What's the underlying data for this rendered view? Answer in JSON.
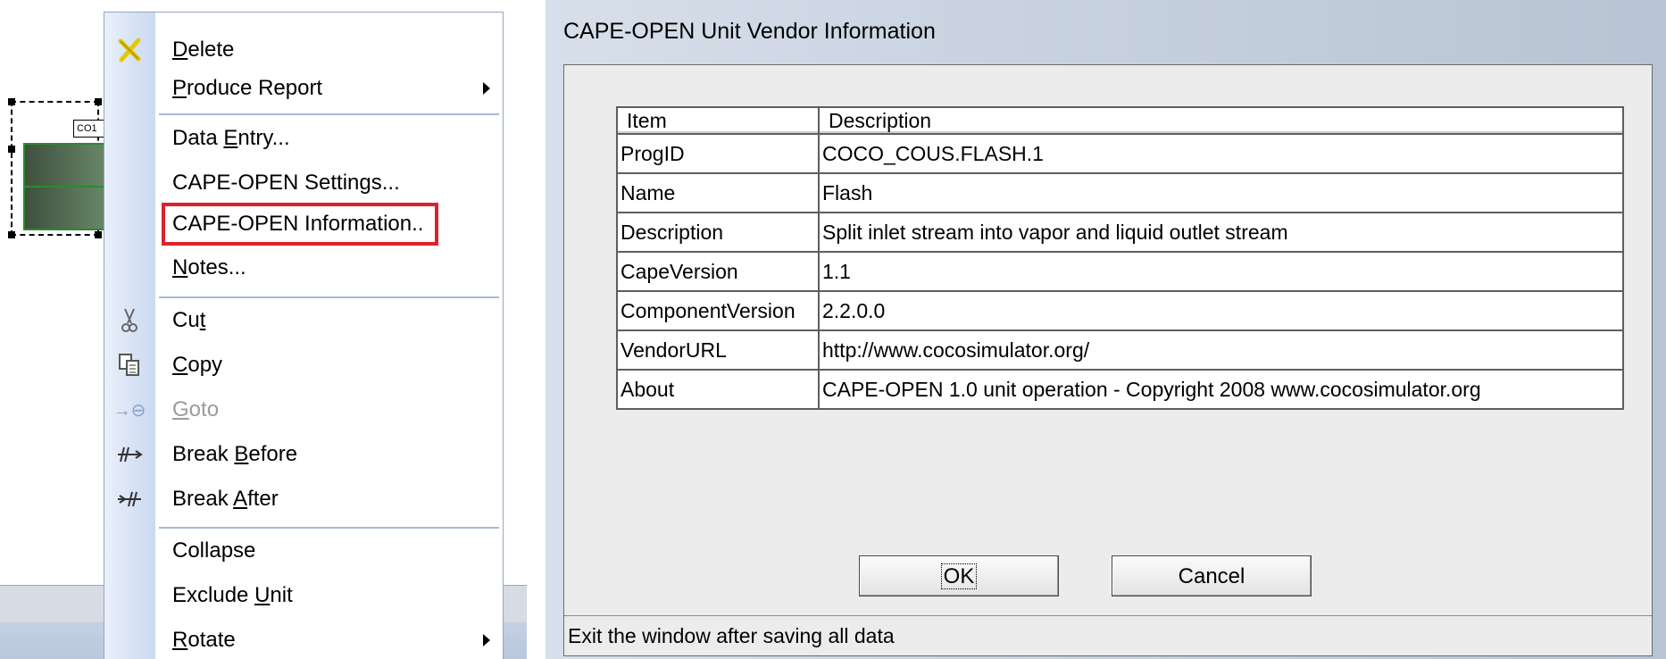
{
  "flowsheet": {
    "unit_tag": "CO1"
  },
  "context_menu": {
    "items": [
      {
        "label": "Delete",
        "icon": "delete-x-icon"
      },
      {
        "label": "Produce Report",
        "submenu": true
      },
      {
        "label": "Data Entry..."
      },
      {
        "label": "CAPE-OPEN Settings..."
      },
      {
        "label": "CAPE-OPEN Information..",
        "highlighted": true,
        "highlight_color": "#e0202a"
      },
      {
        "label": "Notes..."
      },
      {
        "label": "Cut",
        "icon": "scissors-icon"
      },
      {
        "label": "Copy",
        "icon": "copy-icon"
      },
      {
        "label": "Goto",
        "icon": "goto-icon",
        "disabled": true
      },
      {
        "label": "Break Before",
        "icon": "break-before-icon"
      },
      {
        "label": "Break After",
        "icon": "break-after-icon"
      },
      {
        "label": "Collapse"
      },
      {
        "label": "Exclude Unit"
      },
      {
        "label": "Rotate",
        "submenu": true
      }
    ]
  },
  "dialog": {
    "title": "CAPE-OPEN Unit Vendor Information",
    "table": {
      "headers": [
        "Item",
        "Description"
      ],
      "rows": [
        [
          "ProgID",
          "COCO_COUS.FLASH.1"
        ],
        [
          "Name",
          "Flash"
        ],
        [
          "Description",
          "Split inlet stream into vapor and liquid outlet stream"
        ],
        [
          "CapeVersion",
          "1.1"
        ],
        [
          "ComponentVersion",
          "2.2.0.0"
        ],
        [
          "VendorURL",
          "http://www.cocosimulator.org/"
        ],
        [
          "About",
          "CAPE-OPEN 1.0 unit operation - Copyright 2008 www.cocosimulator.org"
        ]
      ]
    },
    "ok_label": "OK",
    "cancel_label": "Cancel",
    "status_text": "Exit the window after saving all data"
  }
}
